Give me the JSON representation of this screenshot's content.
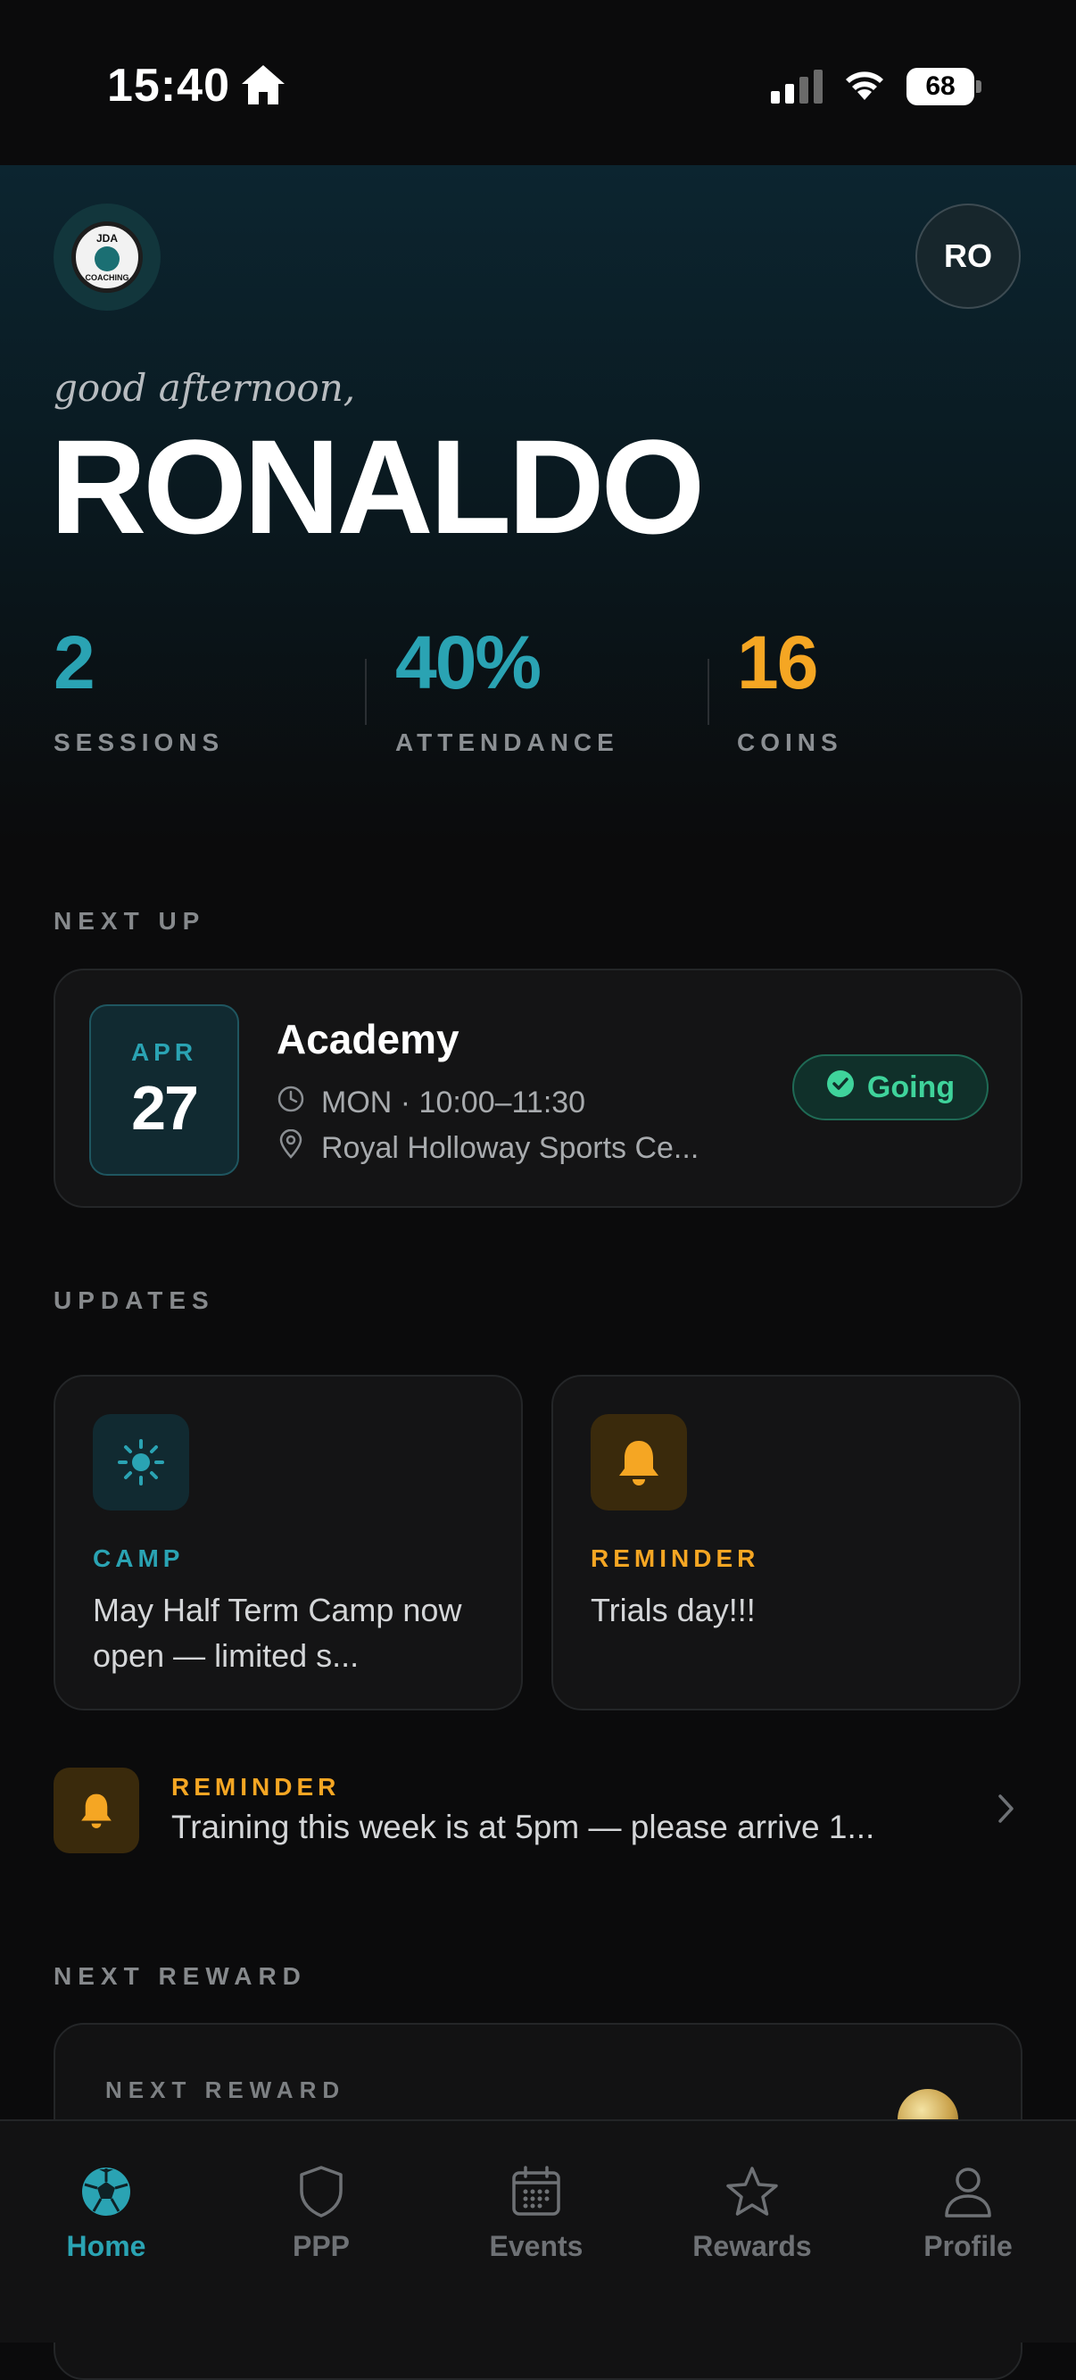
{
  "status_bar": {
    "time": "15:40",
    "battery": "68"
  },
  "header": {
    "avatar_initials": "RO",
    "logo_top": "JDA",
    "logo_bottom": "COACHING"
  },
  "hero": {
    "greeting": "good afternoon,",
    "name": "RONALDO"
  },
  "stats": [
    {
      "value": "2",
      "label": "SESSIONS",
      "color": "#2aa3b3"
    },
    {
      "value": "40%",
      "label": "ATTENDANCE",
      "color": "#2aa3b3"
    },
    {
      "value": "16",
      "label": "COINS",
      "color": "#f5a623"
    }
  ],
  "next_up": {
    "section_title": "NEXT UP",
    "month": "APR",
    "day": "27",
    "title": "Academy",
    "time": "MON · 10:00–11:30",
    "location": "Royal Holloway Sports Ce...",
    "status": "Going"
  },
  "updates": {
    "section_title": "UPDATES",
    "cards": [
      {
        "tag": "CAMP",
        "text": "May Half Term Camp now open — limited s...",
        "icon": "sun-icon",
        "color": "#2aa3b3"
      },
      {
        "tag": "REMINDER",
        "text": "Trials day!!!",
        "icon": "bell-icon",
        "color": "#f5a623"
      }
    ],
    "reminder": {
      "tag": "REMINDER",
      "text": "Training this week is at 5pm — please arrive 1..."
    }
  },
  "next_reward": {
    "section_title": "NEXT REWARD",
    "card_label": "NEXT REWARD"
  },
  "tabs": [
    {
      "label": "Home",
      "icon": "soccer-ball-icon",
      "active": true
    },
    {
      "label": "PPP",
      "icon": "shield-icon",
      "active": false
    },
    {
      "label": "Events",
      "icon": "calendar-icon",
      "active": false
    },
    {
      "label": "Rewards",
      "icon": "star-icon",
      "active": false
    },
    {
      "label": "Profile",
      "icon": "person-icon",
      "active": false
    }
  ]
}
